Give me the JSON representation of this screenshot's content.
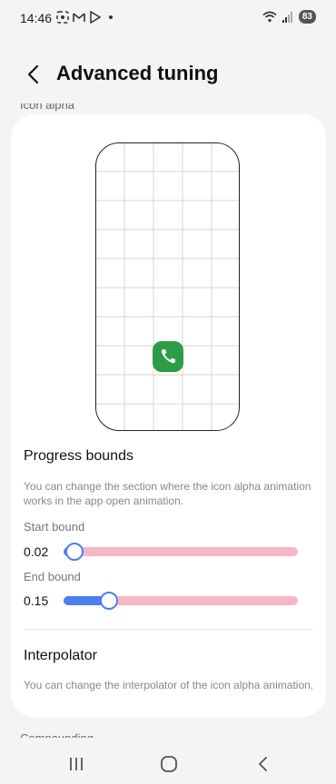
{
  "status": {
    "time": "14:46",
    "battery": "83"
  },
  "header": {
    "title": "Advanced tuning"
  },
  "section_peek": "Icon alpha",
  "progress_bounds": {
    "title": "Progress bounds",
    "description": "You can change the section where the icon alpha animation works in the app open animation.",
    "start": {
      "label": "Start bound",
      "value_text": "0.02",
      "value": 0.02
    },
    "end": {
      "label": "End bound",
      "value_text": "0.15",
      "value": 0.15
    }
  },
  "interpolator": {
    "title": "Interpolator",
    "description": "You can change the interpolator of the icon alpha animation."
  },
  "bottom_peek": "Compounding",
  "colors": {
    "accent": "#4d7ef0",
    "track": "#f6b7c4",
    "app_icon": "#2e9b47"
  },
  "icons": {
    "back": "chevron-left-icon",
    "app": "phone-icon",
    "nav_recent": "recent-apps-icon",
    "nav_home": "home-icon",
    "nav_back": "back-icon"
  }
}
